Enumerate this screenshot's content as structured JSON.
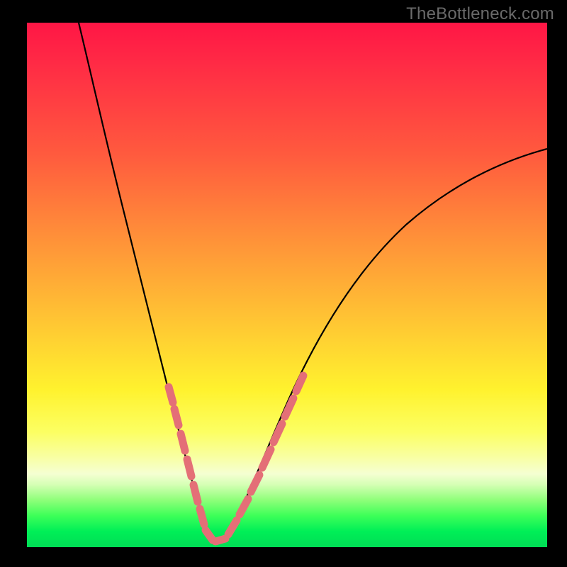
{
  "watermark": "TheBottleneck.com",
  "chart_data": {
    "type": "line",
    "title": "",
    "xlabel": "",
    "ylabel": "",
    "xlim": [
      0,
      100
    ],
    "ylim": [
      0,
      100
    ],
    "series": [
      {
        "name": "bottleneck-curve",
        "x": [
          10,
          12,
          15,
          18,
          21,
          24,
          26,
          28,
          30,
          32,
          34,
          35,
          37,
          40,
          43,
          47,
          52,
          58,
          65,
          73,
          82,
          92,
          100
        ],
        "y": [
          100,
          89,
          74,
          61,
          49,
          38,
          31,
          25,
          18,
          11,
          5,
          1,
          1,
          4,
          10,
          18,
          27,
          36,
          45,
          53,
          60,
          66,
          70
        ]
      }
    ],
    "highlight_band": {
      "name": "marker-points",
      "x": [
        26.5,
        27.5,
        28.5,
        29.2,
        29.8,
        30.5,
        31.2,
        32.0,
        33.0,
        34.0,
        35.0,
        36.5,
        38.5,
        40.0,
        41.5,
        43.0,
        44.5,
        46.0,
        47.5
      ],
      "y": [
        29.0,
        25.5,
        22.0,
        19.0,
        16.0,
        13.0,
        10.0,
        7.0,
        4.0,
        1.8,
        1.0,
        1.2,
        3.0,
        5.5,
        8.5,
        12.0,
        15.5,
        19.0,
        23.0
      ]
    },
    "colors": {
      "curve": "#000000",
      "markers": "#e46f77",
      "gradient_top": "#ff1645",
      "gradient_mid": "#fff22e",
      "gradient_bottom": "#00dd55"
    }
  }
}
